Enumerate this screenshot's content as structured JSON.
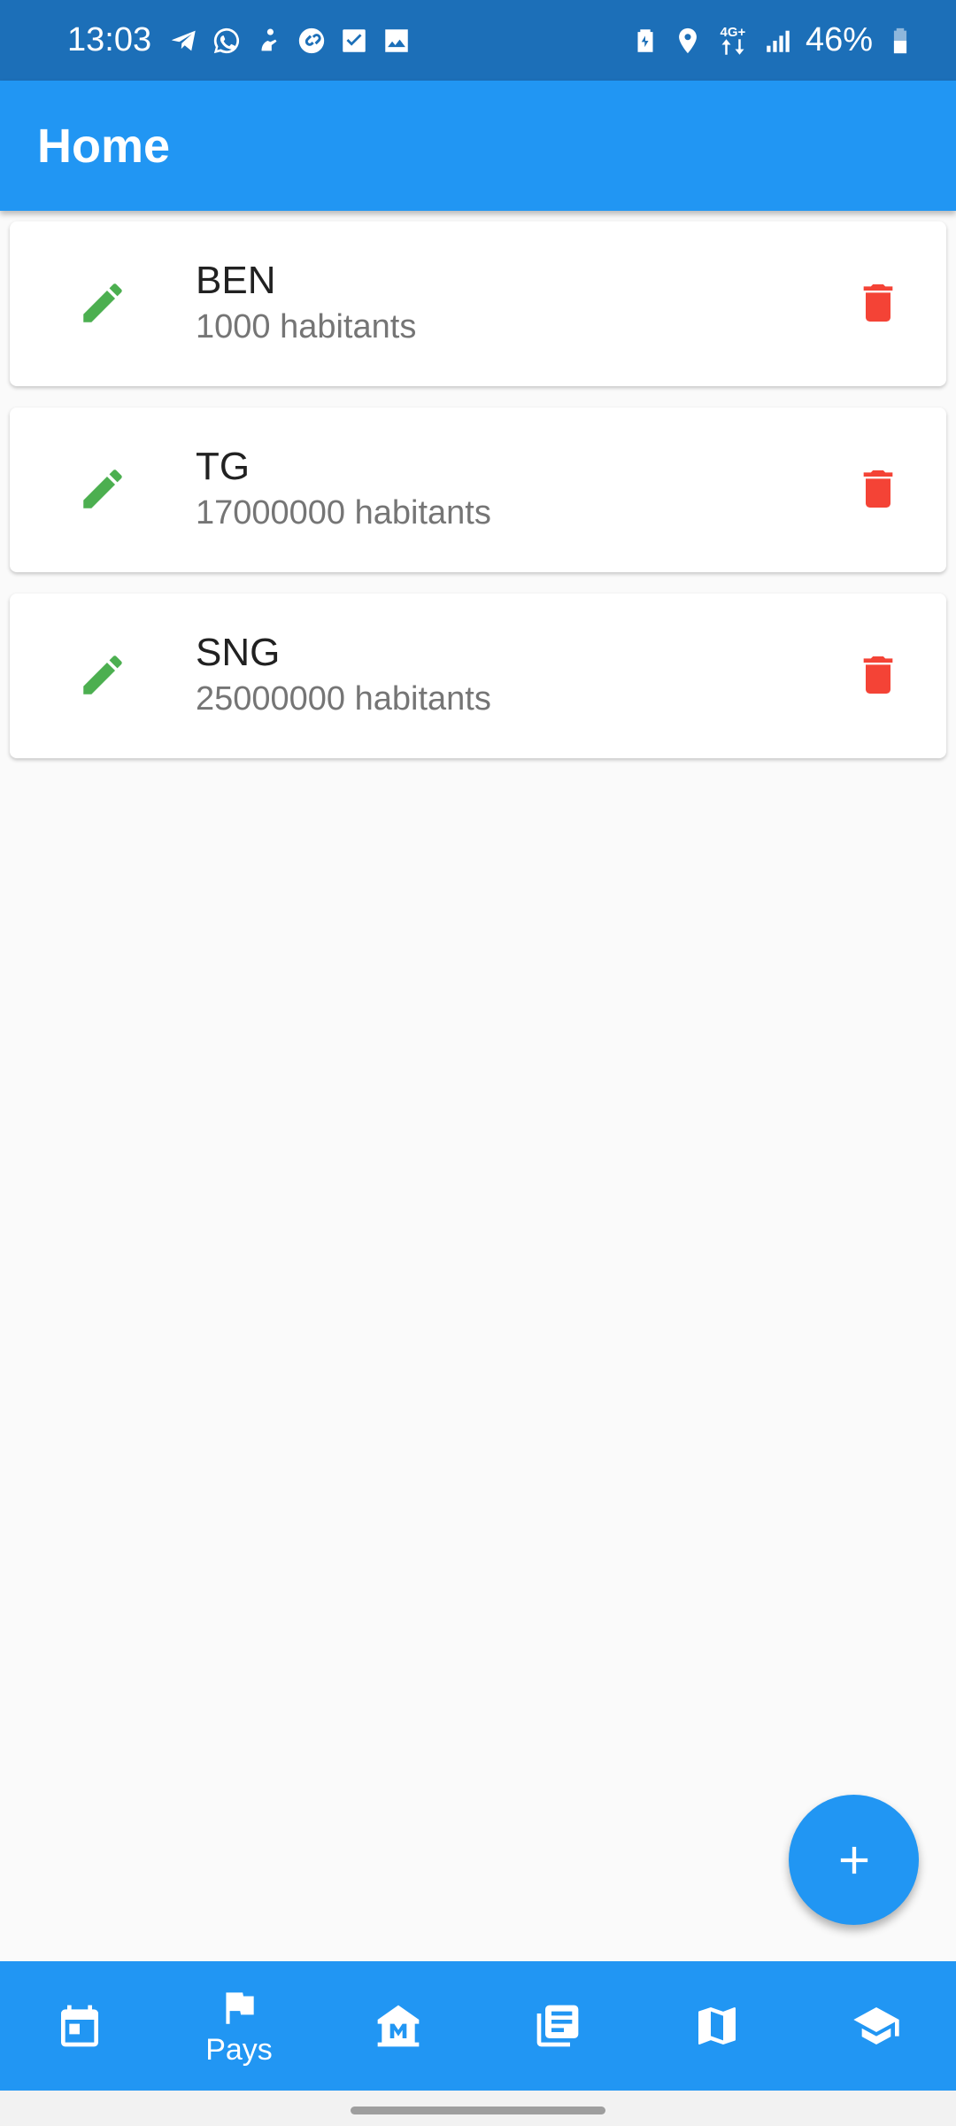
{
  "status_bar": {
    "time": "13:03",
    "battery": "46%",
    "network": "4G+",
    "left_icons": [
      "telegram-icon",
      "whatsapp-icon",
      "notification-icon",
      "shazam-icon",
      "checkbox-icon",
      "gallery-icon"
    ],
    "right_icons": [
      "battery-saver-icon",
      "location-icon",
      "data-arrows-icon",
      "signal-icon",
      "battery-icon"
    ]
  },
  "app_bar": {
    "title": "Home"
  },
  "countries": [
    {
      "name": "BEN",
      "population": "1000 habitants"
    },
    {
      "name": "TG",
      "population": "17000000 habitants"
    },
    {
      "name": "SNG",
      "population": "25000000 habitants"
    }
  ],
  "colors": {
    "primary": "#2196f3",
    "status_bar": "#1c6fb8",
    "edit": "#4caf50",
    "delete": "#f44336"
  },
  "fab": {
    "icon": "add-icon"
  },
  "bottom_nav": {
    "items": [
      {
        "icon": "calendar-icon",
        "label": ""
      },
      {
        "icon": "flag-icon",
        "label": "Pays",
        "active": true
      },
      {
        "icon": "museum-icon",
        "label": ""
      },
      {
        "icon": "library-books-icon",
        "label": ""
      },
      {
        "icon": "map-icon",
        "label": ""
      },
      {
        "icon": "school-icon",
        "label": ""
      }
    ]
  }
}
